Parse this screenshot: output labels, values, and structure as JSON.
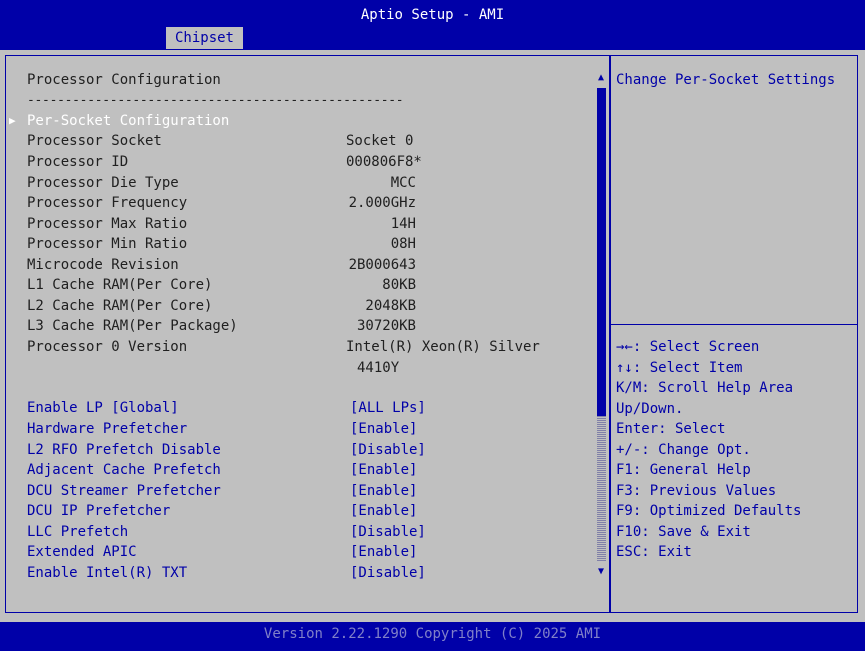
{
  "window": {
    "title": "Aptio Setup - AMI"
  },
  "tabs": [
    {
      "label": "Chipset"
    }
  ],
  "section": {
    "title": "Processor Configuration",
    "separator": "--------------------------------------------------",
    "submenu": "Per-Socket Configuration"
  },
  "info_rows": [
    {
      "label": "Processor Socket",
      "value": "Socket 0"
    },
    {
      "label": "Processor ID",
      "value": "000806F8*"
    },
    {
      "label": "Processor Die Type",
      "value": "MCC"
    },
    {
      "label": "Processor Frequency",
      "value": "2.000GHz"
    },
    {
      "label": "Processor Max Ratio",
      "value": "14H"
    },
    {
      "label": "Processor Min Ratio",
      "value": "08H"
    },
    {
      "label": "Microcode Revision",
      "value": "2B000643"
    },
    {
      "label": "L1 Cache RAM(Per Core)",
      "value": "80KB"
    },
    {
      "label": "L2 Cache RAM(Per Core)",
      "value": "2048KB"
    },
    {
      "label": "L3 Cache RAM(Per Package)",
      "value": "30720KB"
    },
    {
      "label": "Processor 0 Version",
      "value": "Intel(R) Xeon(R) Silver",
      "value_line2": "4410Y"
    }
  ],
  "options": [
    {
      "label": "Enable LP [Global]",
      "value": "[ALL LPs]"
    },
    {
      "label": "Hardware Prefetcher",
      "value": "[Enable]"
    },
    {
      "label": "L2 RFO Prefetch Disable",
      "value": "[Disable]"
    },
    {
      "label": "Adjacent Cache Prefetch",
      "value": "[Enable]"
    },
    {
      "label": "DCU Streamer Prefetcher",
      "value": "[Enable]"
    },
    {
      "label": "DCU IP Prefetcher",
      "value": "[Enable]"
    },
    {
      "label": "LLC Prefetch",
      "value": "[Disable]"
    },
    {
      "label": "Extended APIC",
      "value": "[Enable]"
    },
    {
      "label": "Enable Intel(R) TXT",
      "value": "[Disable]"
    }
  ],
  "help": {
    "description": "Change Per-Socket Settings"
  },
  "key_help": [
    "→←: Select Screen",
    "↑↓: Select Item",
    "K/M: Scroll Help Area",
    "Up/Down.",
    "Enter: Select",
    "+/-: Change Opt.",
    "F1: General Help",
    "F3: Previous Values",
    "F9: Optimized Defaults",
    "F10: Save & Exit",
    "ESC: Exit"
  ],
  "icons": {
    "submenu_arrow": "triangle-right",
    "scroll_up": "triangle-up",
    "scroll_down": "triangle-down"
  },
  "colors": {
    "background": "#0000A8",
    "panel": "#C0C0C0",
    "text": "#202020",
    "option_text": "#0000A8",
    "selected_text": "#FFFFFF"
  },
  "footer": {
    "version": "Version 2.22.1290 Copyright (C) 2025 AMI"
  }
}
